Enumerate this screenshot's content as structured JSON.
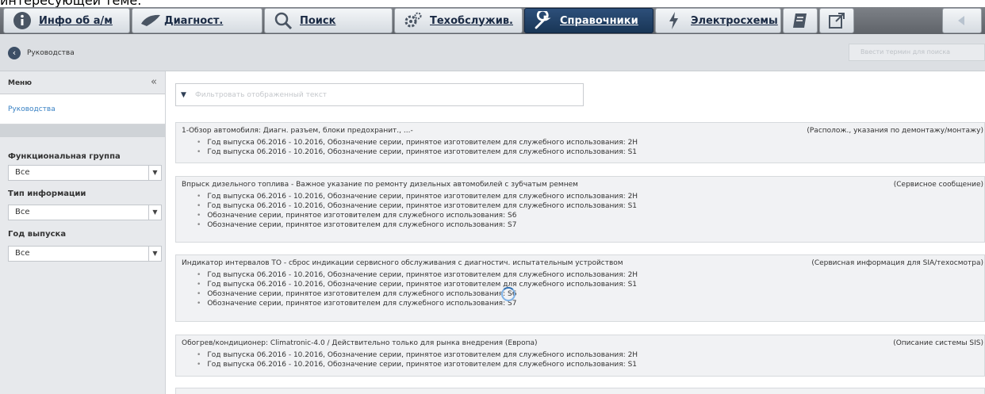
{
  "top_text": "интересующей теме.",
  "toolbar": {
    "tabs": [
      {
        "label": "Инфо об а/м",
        "icon": "info-icon"
      },
      {
        "label": "Диагност.",
        "icon": "diagnostics-icon"
      },
      {
        "label": "Поиск",
        "icon": "search-icon"
      },
      {
        "label": "Техобслужив.",
        "icon": "gears-icon"
      },
      {
        "label": "Справочники",
        "icon": "wrench-icon",
        "active": true
      },
      {
        "label": "Электросхемы",
        "icon": "lightning-icon"
      }
    ],
    "extra_icons": [
      "book-icon",
      "external-link-icon",
      "back-arrow-icon"
    ]
  },
  "breadcrumb": {
    "label": "Руководства"
  },
  "search_term": {
    "placeholder": "Ввести термин для поиска"
  },
  "sidebar": {
    "menu_label": "Меню",
    "collapse": "«",
    "link": "Руководства",
    "filters": [
      {
        "label": "Функциональная группа",
        "value": "Все"
      },
      {
        "label": "Тип информации",
        "value": "Все"
      },
      {
        "label": "Год выпуска",
        "value": "Все"
      }
    ]
  },
  "filter_box": {
    "placeholder": "Фильтровать отображенный текст"
  },
  "documents": [
    {
      "title": "1-Обзор автомобиля: Диагн. разъем, блоки предохранит., ...-",
      "category": "(Располож., указания по демонтажу/монтажу)",
      "items": [
        "Год выпуска 06.2016 - 10.2016, Обозначение серии, принятое изготовителем для служебного использования: 2H",
        "Год выпуска 06.2016 - 10.2016, Обозначение серии, принятое изготовителем для служебного использования: S1"
      ]
    },
    {
      "title": "Впрыск дизельного топлива - Важное указание по ремонту дизельных автомобилей с зубчатым ремнем",
      "category": "(Сервисное сообщение)",
      "items": [
        "Год выпуска 06.2016 - 10.2016, Обозначение серии, принятое изготовителем для служебного использования: 2H",
        "Год выпуска 06.2016 - 10.2016, Обозначение серии, принятое изготовителем для служебного использования: S1",
        "Обозначение серии, принятое изготовителем для служебного использования: S6",
        "Обозначение серии, принятое изготовителем для служебного использования: S7"
      ]
    },
    {
      "title": "Индикатор интервалов ТО - сброс индикации сервисного обслуживания с диагностич. испытательным устройством",
      "category": "(Сервисная информация для SIA/техосмотра)",
      "items": [
        "Год выпуска 06.2016 - 10.2016, Обозначение серии, принятое изготовителем для служебного использования: 2H",
        "Год выпуска 06.2016 - 10.2016, Обозначение серии, принятое изготовителем для служебного использования: S1",
        "Обозначение серии, принятое изготовителем для служебного использования: S6",
        "Обозначение серии, принятое изготовителем для служебного использования: S7"
      ]
    },
    {
      "title": "Обогрев/кондиционер: Climatronic-4.0 / Действительно только для рынка внедрения (Европа)",
      "category": "(Описание системы SIS)",
      "items": [
        "Год выпуска 06.2016 - 10.2016, Обозначение серии, принятое изготовителем для служебного использования: 2H",
        "Год выпуска 06.2016 - 10.2016, Обозначение серии, принятое изготовителем для служебного использования: S1"
      ]
    }
  ]
}
